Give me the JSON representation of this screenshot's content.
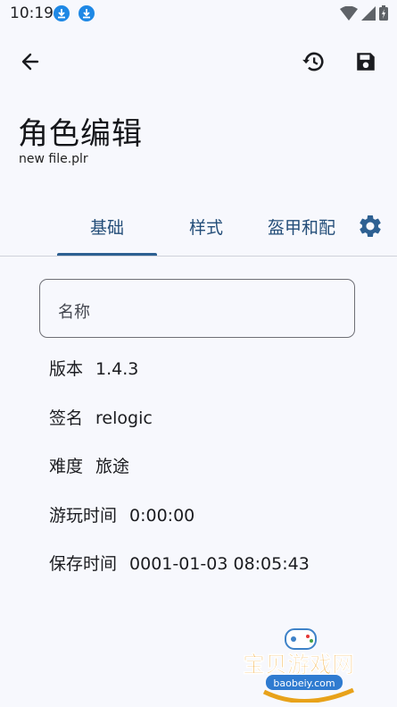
{
  "status_bar": {
    "time": "10:19"
  },
  "app_bar": {
    "back_icon": "arrow-back-icon",
    "history_icon": "history-icon",
    "save_icon": "save-icon"
  },
  "page": {
    "title": "角色编辑",
    "file_name": "new file.plr"
  },
  "tabs": [
    {
      "label": "基础",
      "selected": true
    },
    {
      "label": "样式",
      "selected": false
    },
    {
      "label": "盔甲和配",
      "selected": false
    }
  ],
  "settings_icon": "gear-icon",
  "name_field": {
    "placeholder": "名称",
    "value": ""
  },
  "info": [
    {
      "label": "版本",
      "value": "1.4.3"
    },
    {
      "label": "签名",
      "value": "relogic"
    },
    {
      "label": "难度",
      "value": "旅途"
    },
    {
      "label": "游玩时间",
      "value": "0:00:00"
    },
    {
      "label": "保存时间",
      "value": "0001-01-03 08:05:43"
    }
  ],
  "watermark": {
    "text": "宝贝游戏网",
    "url": "baobeiy.com"
  },
  "colors": {
    "background": "#f7f8fd",
    "accent": "#2d6092",
    "tab_text": "#244e79"
  }
}
